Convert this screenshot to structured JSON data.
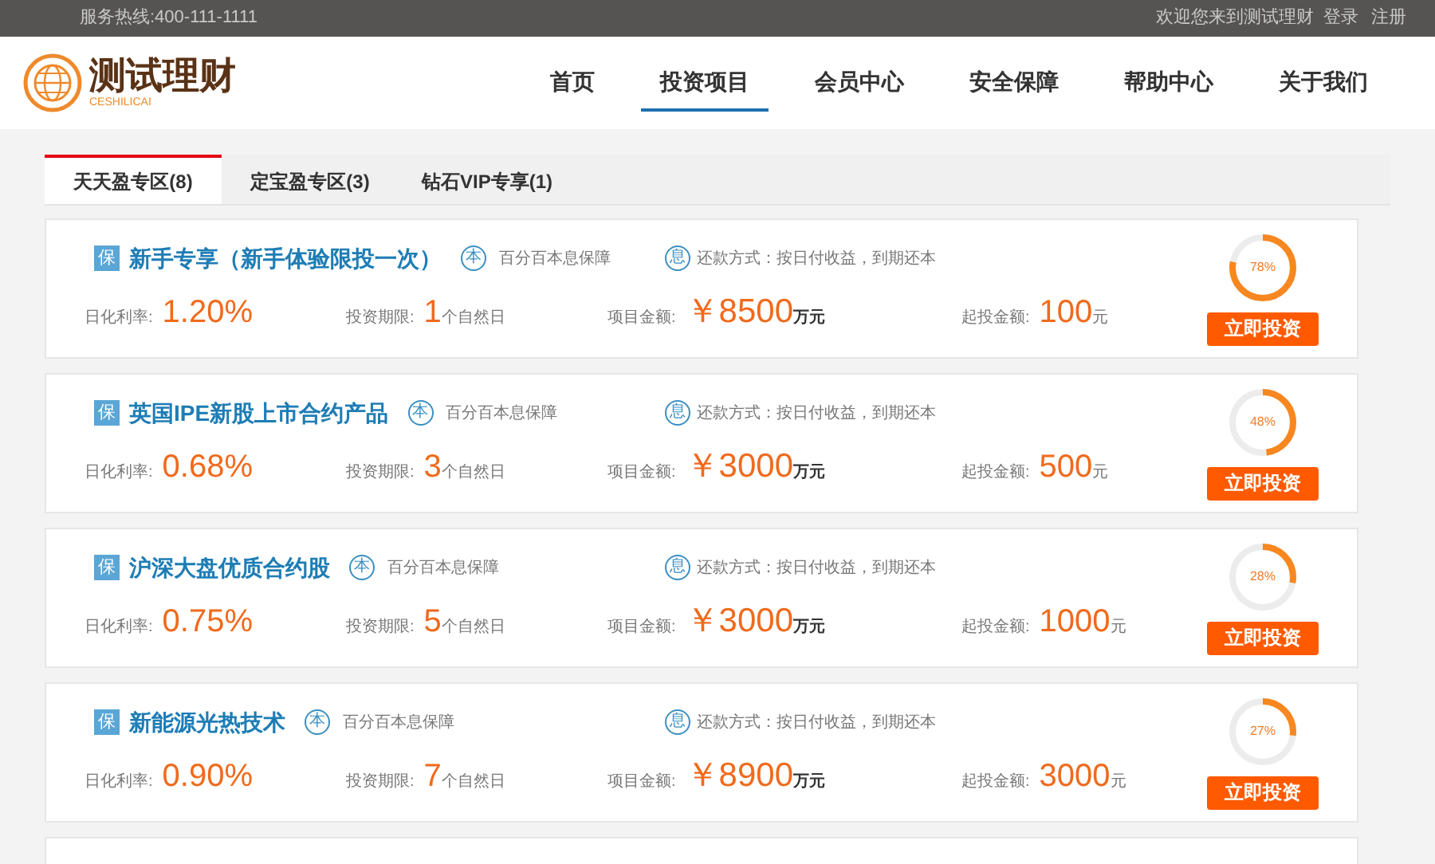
{
  "top_bar": {
    "hotline": "服务热线:400-111-1111",
    "welcome": "欢迎您来到测试理财",
    "login": "登录",
    "register": "注册"
  },
  "logo": {
    "name": "测试理财",
    "subtitle": "CESHILICAI"
  },
  "nav": [
    {
      "label": "首页",
      "selected": false
    },
    {
      "label": "投资项目",
      "selected": true
    },
    {
      "label": "会员中心",
      "selected": false
    },
    {
      "label": "安全保障",
      "selected": false
    },
    {
      "label": "帮助中心",
      "selected": false
    },
    {
      "label": "关于我们",
      "selected": false
    }
  ],
  "tabs": [
    {
      "label": "天天盈专区(8)",
      "selected": true
    },
    {
      "label": "定宝盈专区(3)",
      "selected": false
    },
    {
      "label": "钻石VIP专享(1)",
      "selected": false
    }
  ],
  "products": [
    {
      "badge": "保",
      "title": "新手专享（新手体验限投一次）",
      "guarantee_icon": "本",
      "guarantee": "百分百本息保障",
      "repay_icon": "息",
      "repay": "还款方式：按日付收益，到期还本",
      "rate_label": "日化利率:",
      "rate": "1.20%",
      "term_label": "投资期限:",
      "term": "1",
      "term_unit": "个自然日",
      "amount_label": "项目金额:",
      "amount": "￥8500",
      "amount_unit": "万元",
      "min_label": "起投金额:",
      "min": "100",
      "min_unit": "元",
      "progress": "78%",
      "level": 0.78,
      "button": "立即投资"
    },
    {
      "badge": "保",
      "title": "英国IPE新股上市合约产品",
      "guarantee_icon": "本",
      "guarantee": "百分百本息保障",
      "repay_icon": "息",
      "repay": "还款方式：按日付收益，到期还本",
      "rate_label": "日化利率:",
      "rate": "0.68%",
      "term_label": "投资期限:",
      "term": "3",
      "term_unit": "个自然日",
      "amount_label": "项目金额:",
      "amount": "￥3000",
      "amount_unit": "万元",
      "min_label": "起投金额:",
      "min": "500",
      "min_unit": "元",
      "progress": "48%",
      "level": 0.48,
      "button": "立即投资"
    },
    {
      "badge": "保",
      "title": "沪深大盘优质合约股",
      "guarantee_icon": "本",
      "guarantee": "百分百本息保障",
      "repay_icon": "息",
      "repay": "还款方式：按日付收益，到期还本",
      "rate_label": "日化利率:",
      "rate": "0.75%",
      "term_label": "投资期限:",
      "term": "5",
      "term_unit": "个自然日",
      "amount_label": "项目金额:",
      "amount": "￥3000",
      "amount_unit": "万元",
      "min_label": "起投金额:",
      "min": "1000",
      "min_unit": "元",
      "progress": "28%",
      "level": 0.28,
      "button": "立即投资"
    },
    {
      "badge": "保",
      "title": "新能源光热技术",
      "guarantee_icon": "本",
      "guarantee": "百分百本息保障",
      "repay_icon": "息",
      "repay": "还款方式：按日付收益，到期还本",
      "rate_label": "日化利率:",
      "rate": "0.90%",
      "term_label": "投资期限:",
      "term": "7",
      "term_unit": "个自然日",
      "amount_label": "项目金额:",
      "amount": "￥8900",
      "amount_unit": "万元",
      "min_label": "起投金额:",
      "min": "3000",
      "min_unit": "元",
      "progress": "27%",
      "level": 0.27,
      "button": "立即投资"
    }
  ]
}
